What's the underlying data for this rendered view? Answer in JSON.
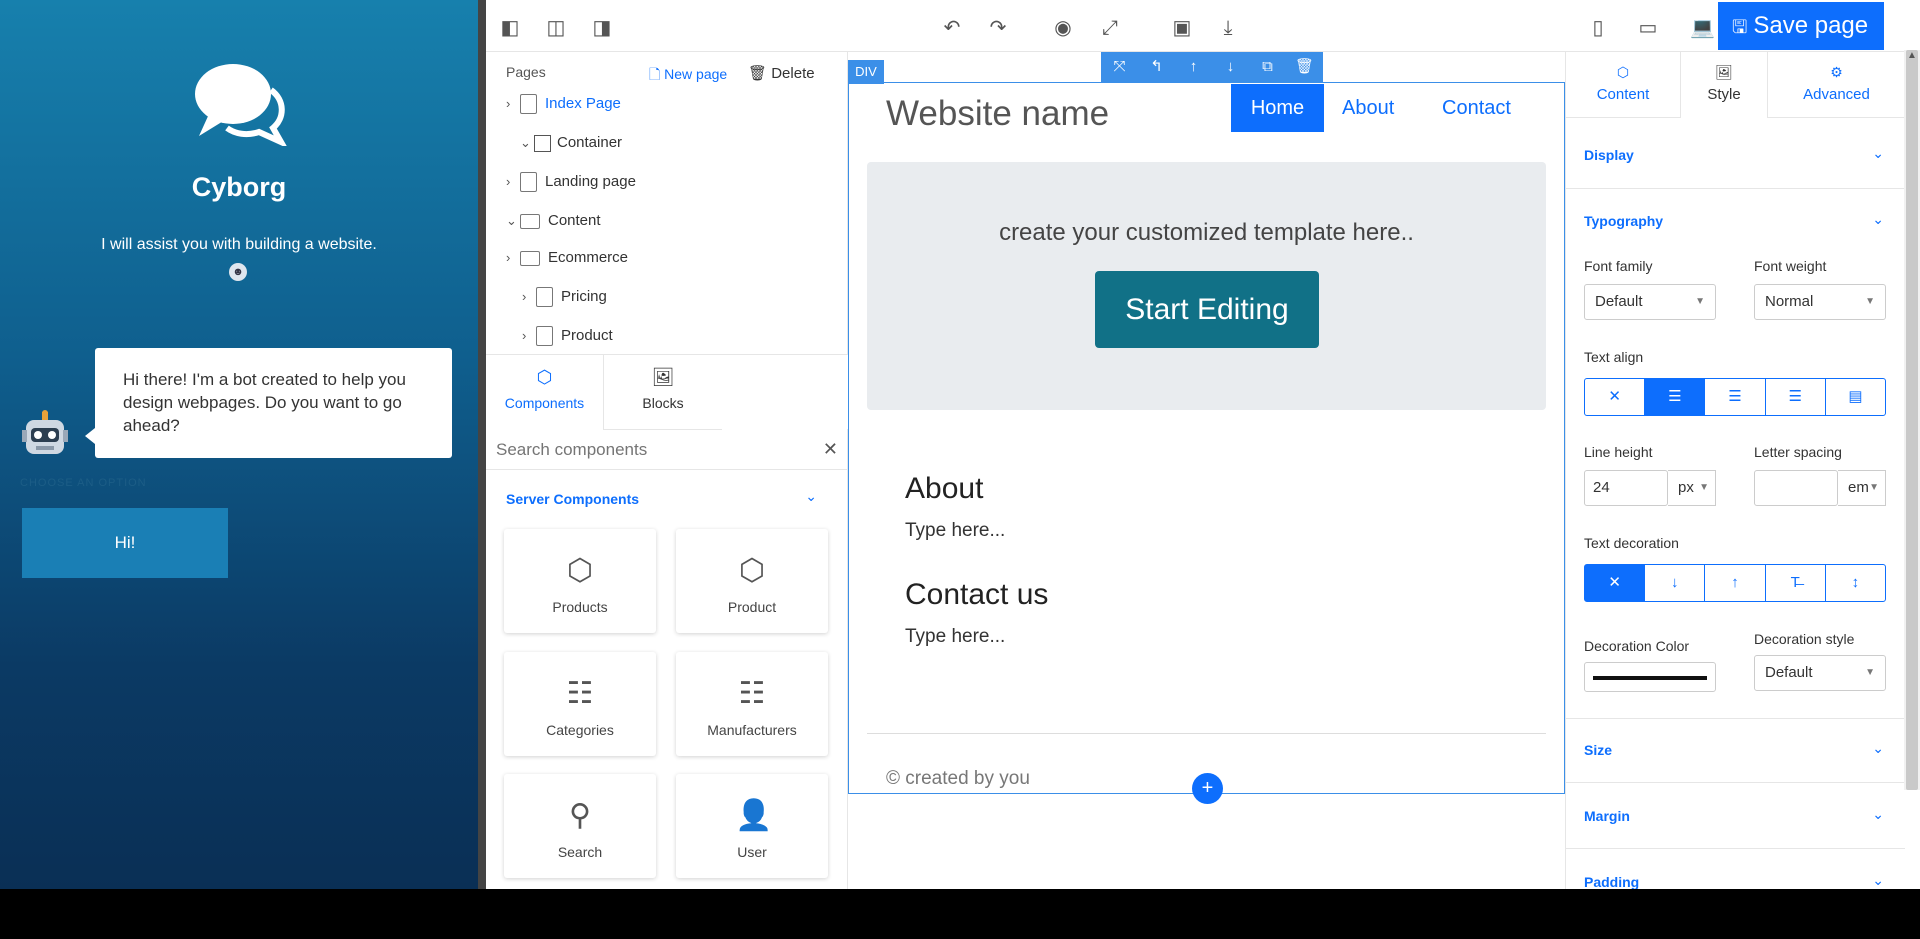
{
  "chat": {
    "title": "Cyborg",
    "subtitle": "I will assist you with building a website.",
    "bot_message": "Hi there! I'm a bot created to help you design webpages. Do you want to go ahead?",
    "choose_option": "CHOOSE AN OPTION",
    "option_hi": "Hi!"
  },
  "toolbar": {
    "save_label": "Save page"
  },
  "pages": {
    "header": "Pages",
    "new_page": "New page",
    "delete": "Delete",
    "items": [
      {
        "label": "Index Page"
      },
      {
        "label": "Container"
      },
      {
        "label": "Landing page"
      },
      {
        "label": "Content"
      },
      {
        "label": "Ecommerce"
      },
      {
        "label": "Pricing"
      },
      {
        "label": "Product"
      }
    ]
  },
  "left_tabs": {
    "components": "Components",
    "blocks": "Blocks"
  },
  "search": {
    "placeholder": "Search components"
  },
  "server_components": {
    "header": "Server Components",
    "items": [
      {
        "label": "Products"
      },
      {
        "label": "Product"
      },
      {
        "label": "Categories"
      },
      {
        "label": "Manufacturers"
      },
      {
        "label": "Search"
      },
      {
        "label": "User"
      }
    ]
  },
  "canvas": {
    "badge": "DIV",
    "site_name": "Website name",
    "nav": [
      "Home",
      "About",
      "Contact"
    ],
    "hero_text": "create your customized template here..",
    "hero_button": "Start Editing",
    "about_title": "About",
    "about_text": "Type here...",
    "contact_title": "Contact us",
    "contact_text": "Type here...",
    "footer": "© created by you"
  },
  "right_tabs": {
    "content": "Content",
    "style": "Style",
    "advanced": "Advanced"
  },
  "style_panel": {
    "display": "Display",
    "typography": "Typography",
    "font_family_label": "Font family",
    "font_family_value": "Default",
    "font_weight_label": "Font weight",
    "font_weight_value": "Normal",
    "text_align_label": "Text align",
    "line_height_label": "Line height",
    "line_height_value": "24",
    "line_height_unit": "px",
    "letter_spacing_label": "Letter spacing",
    "letter_spacing_value": "",
    "letter_spacing_unit": "em",
    "text_decoration_label": "Text decoration",
    "decoration_color_label": "Decoration Color",
    "decoration_color": "#111111",
    "decoration_style_label": "Decoration style",
    "decoration_style_value": "Default",
    "size": "Size",
    "margin": "Margin",
    "padding": "Padding"
  },
  "colors": {
    "accent": "#0d6efd",
    "hero_button": "#117187",
    "chat_top": "#1780ad",
    "chat_bottom": "#0a2f55"
  }
}
